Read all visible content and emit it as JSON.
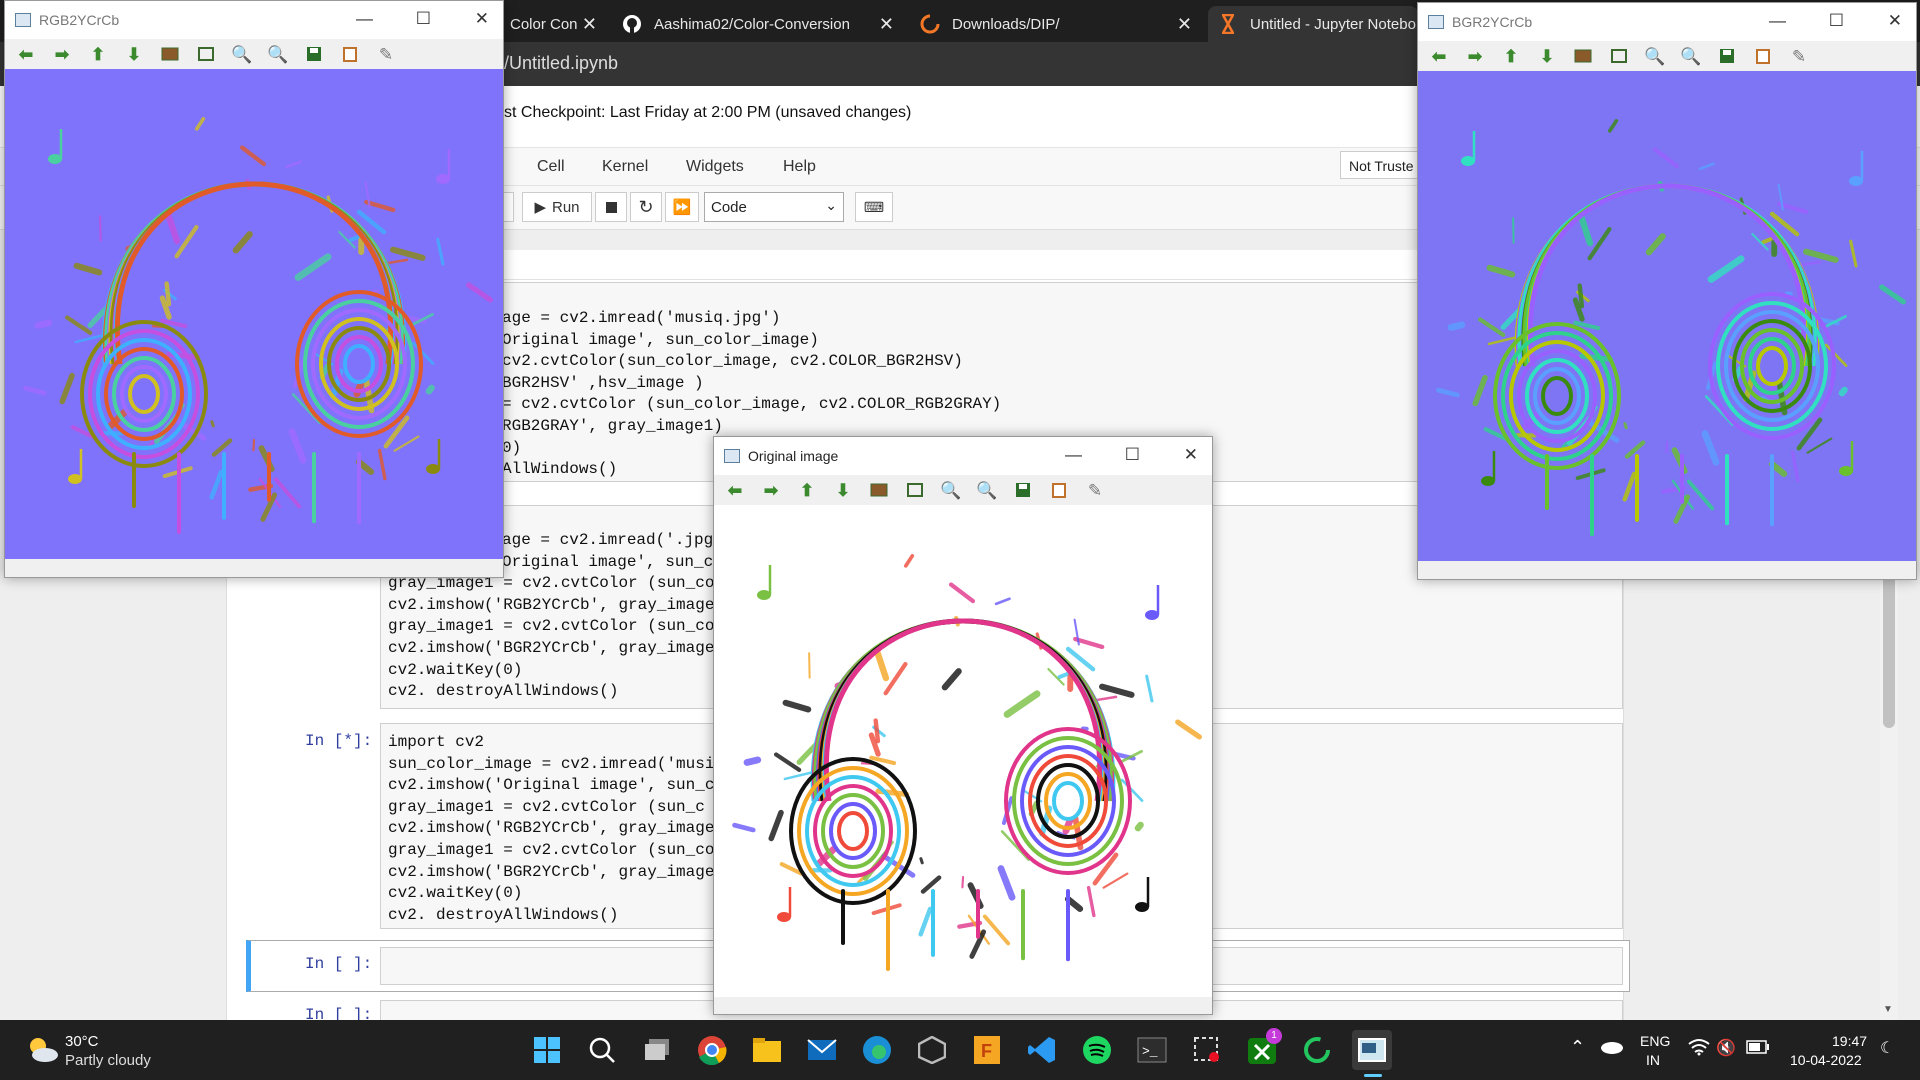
{
  "browser": {
    "tabs": [
      {
        "label": "Color Con",
        "icon": "tab-favicon"
      },
      {
        "label": "Aashima02/Color-Conversion",
        "icon": "github-icon"
      },
      {
        "label": "Downloads/DIP/",
        "icon": "jupyter-spinner-icon"
      },
      {
        "label": "Untitled - Jupyter Notebo",
        "icon": "jupyter-hourglass-icon"
      }
    ],
    "address": "/Untitled.ipynb"
  },
  "jupyter": {
    "checkpoint": "st Checkpoint: Last Friday at 2:00 PM   (unsaved changes)",
    "menu": [
      "Cell",
      "Kernel",
      "Widgets",
      "Help"
    ],
    "trusted": "Not Truste",
    "toolbar": {
      "run": "Run",
      "cell_type": "Code"
    },
    "cells": [
      {
        "prompt": "",
        "lines": [
          "age = cv2.imread('musiq.jpg')",
          "Original image', sun_color_image)",
          "cv2.cvtColor(sun_color_image, cv2.COLOR_BGR2HSV)",
          "BGR2HSV' ,hsv_image )",
          "= cv2.cvtColor (sun_color_image, cv2.COLOR_RGB2GRAY)",
          "RGB2GRAY', gray_image1)",
          "0)",
          "AllWindows()"
        ]
      },
      {
        "prompt": "",
        "lines": [
          "age = cv2.imread('.jpg",
          "Original image', sun_c",
          "gray_image1 = cv2.cvtColor (sun_co",
          "cv2.imshow('RGB2YCrCb', gray_image",
          "gray_image1 = cv2.cvtColor (sun_co",
          "cv2.imshow('BGR2YCrCb', gray_image",
          "cv2.waitKey(0)",
          "cv2. destroyAllWindows()"
        ]
      },
      {
        "prompt": "In [*]:",
        "lines": [
          "import cv2",
          "sun_color_image = cv2.imread('musi",
          "cv2.imshow('Original image', sun_c",
          "gray_image1 = cv2.cvtColor (sun_c",
          "cv2.imshow('RGB2YCrCb', gray_image",
          "gray_image1 = cv2.cvtColor (sun_co",
          "cv2.imshow('BGR2YCrCb', gray_image",
          "cv2.waitKey(0)",
          "cv2. destroyAllWindows()"
        ]
      },
      {
        "prompt": "In [ ]:",
        "lines": []
      },
      {
        "prompt": "In [ ]:",
        "lines": []
      }
    ]
  },
  "windows": {
    "left": {
      "title": "RGB2YCrCb",
      "bg": "#8073fb"
    },
    "right": {
      "title": "BGR2YCrCb",
      "bg": "#7e75f5"
    },
    "center": {
      "title": "Original image",
      "bg": "#ffffff"
    }
  },
  "taskbar": {
    "weather_temp": "30°C",
    "weather_text": "Partly cloudy",
    "lang_top": "ENG",
    "lang_bottom": "IN",
    "time": "19:47",
    "date": "10-04-2022",
    "xbox_badge": "1"
  }
}
